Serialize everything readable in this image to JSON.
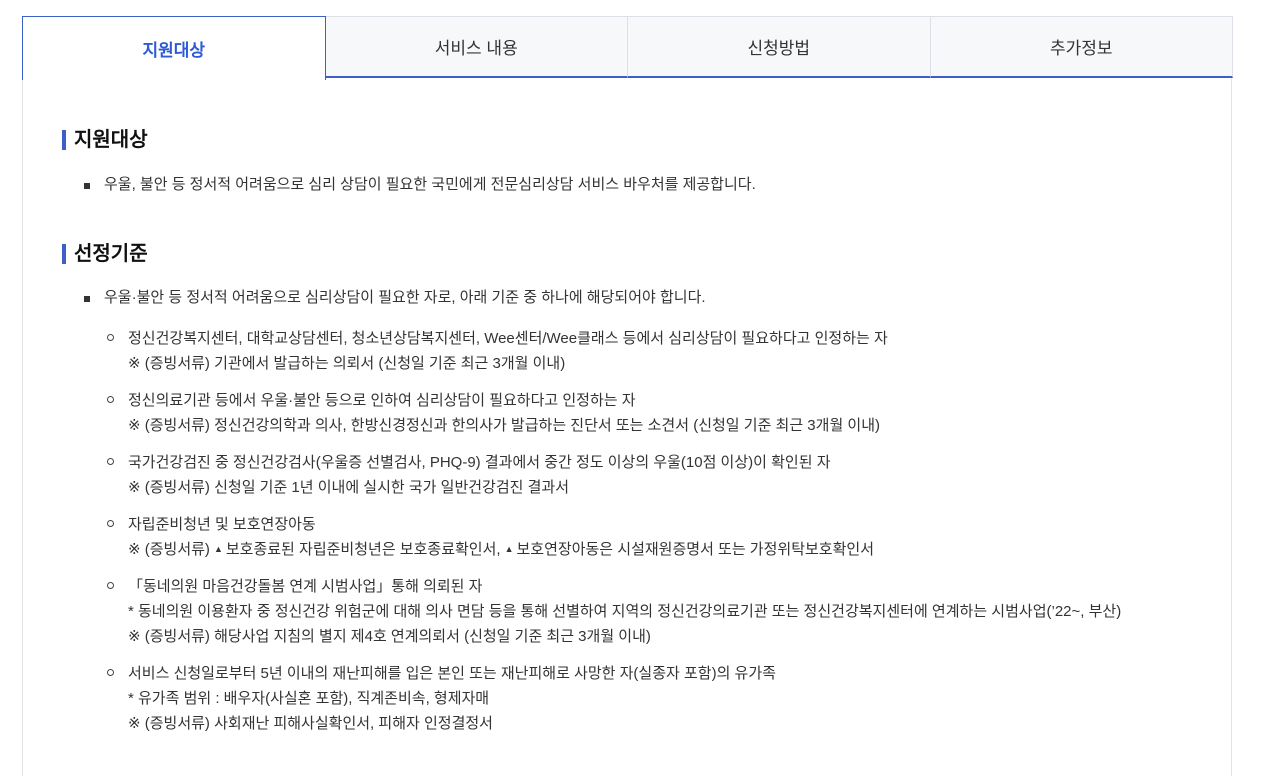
{
  "tabs": [
    {
      "label": "지원대상"
    },
    {
      "label": "서비스 내용"
    },
    {
      "label": "신청방법"
    },
    {
      "label": "추가정보"
    }
  ],
  "target": {
    "title": "지원대상",
    "text": "우울, 불안 등 정서적 어려움으로 심리 상담이 필요한 국민에게 전문심리상담 서비스 바우처를 제공합니다."
  },
  "criteria": {
    "title": "선정기준",
    "intro": "우울·불안 등 정서적 어려움으로 심리상담이 필요한 자로, 아래 기준 중 하나에 해당되어야 합니다.",
    "items": [
      {
        "main": "정신건강복지센터, 대학교상담센터, 청소년상담복지센터, Wee센터/Wee클래스 등에서 심리상담이 필요하다고 인정하는 자",
        "note1": "※ (증빙서류) 기관에서 발급하는 의뢰서 (신청일 기준 최근 3개월 이내)"
      },
      {
        "main": "정신의료기관 등에서 우울·불안 등으로 인하여 심리상담이 필요하다고 인정하는 자",
        "note1": "※ (증빙서류) 정신건강의학과 의사, 한방신경정신과 한의사가 발급하는 진단서 또는 소견서 (신청일 기준 최근 3개월 이내)"
      },
      {
        "main": "국가건강검진 중 정신건강검사(우울증 선별검사, PHQ-9) 결과에서 중간 정도 이상의 우울(10점 이상)이 확인된 자",
        "note1": "※ (증빙서류) 신청일 기준 1년 이내에 실시한 국가 일반건강검진 결과서"
      },
      {
        "main": "자립준비청년 및 보호연장아동",
        "note_prefix": "※ (증빙서류)",
        "note_a": "보호종료된 자립준비청년은 보호종료확인서,",
        "note_b": "보호연장아동은 시설재원증명서 또는 가정위탁보호확인서"
      },
      {
        "main": "「동네의원 마음건강돌봄 연계 시범사업」통해 의뢰된 자",
        "note1": "* 동네의원 이용환자 중 정신건강 위험군에 대해 의사 면담 등을 통해 선별하여 지역의 정신건강의료기관 또는 정신건강복지센터에 연계하는 시범사업(’22~, 부산)",
        "note2": "※ (증빙서류) 해당사업 지침의 별지 제4호 연계의뢰서 (신청일 기준 최근 3개월 이내)"
      },
      {
        "main": "서비스 신청일로부터 5년 이내의 재난피해를 입은 본인 또는 재난피해로 사망한 자(실종자 포함)의 유가족",
        "note1": "* 유가족 범위 : 배우자(사실혼 포함), 직계존비속, 형제자매",
        "note2": "※ (증빙서류) 사회재난 피해사실확인서, 피해자 인정결정서"
      }
    ]
  }
}
